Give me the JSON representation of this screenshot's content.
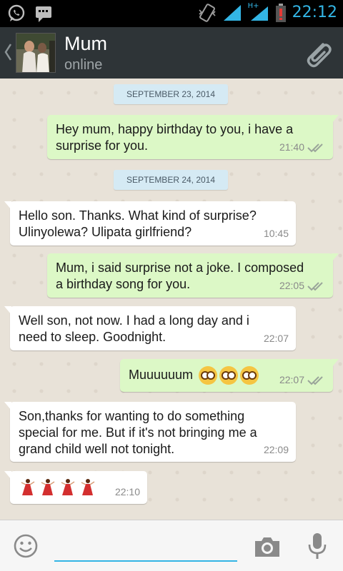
{
  "status_bar": {
    "time": "22:12",
    "network": "H+",
    "left_icons": [
      "whatsapp-icon",
      "message-icon"
    ],
    "right_icons": [
      "vibrate-icon",
      "signal-icon",
      "signal-icon",
      "battery-low-icon"
    ]
  },
  "header": {
    "contact_name": "Mum",
    "status": "online",
    "icons": [
      "back-chevron-icon",
      "avatar",
      "paperclip-icon"
    ]
  },
  "conversation": {
    "dates": [
      "SEPTEMBER 23, 2014",
      "SEPTEMBER 24, 2014"
    ],
    "messages": [
      {
        "direction": "out",
        "line1": "Hey mum, happy birthday to you, i have a",
        "line2": "surprise for you.",
        "time": "21:40",
        "ticks": "double"
      },
      {
        "direction": "in",
        "line1": "Hello son. Thanks. What kind of surprise?",
        "line2": "Ulinyolewa? Ulipata girlfriend?",
        "time": "10:45"
      },
      {
        "direction": "out",
        "line1": "Mum, i said surprise not a joke. I composed",
        "line2": "a birthday song for you.",
        "time": "22:05",
        "ticks": "double"
      },
      {
        "direction": "in",
        "line1": "Well son, not now. I had a long day and i",
        "line2": "need to sleep. Goodnight.",
        "time": "22:07"
      },
      {
        "direction": "out",
        "text": "Muuuuuum",
        "emoji": [
          "flushed-face-emoji",
          "flushed-face-emoji",
          "flushed-face-emoji"
        ],
        "time": "22:07",
        "ticks": "double"
      },
      {
        "direction": "in",
        "line1": "Son,thanks for wanting to do something",
        "line2": "special for me. But if it's not bringing me a",
        "line3": "grand child well not tonight.",
        "time": "22:09"
      },
      {
        "direction": "in",
        "emoji": [
          "dancer-emoji",
          "dancer-emoji",
          "dancer-emoji",
          "dancer-emoji"
        ],
        "time": "22:10"
      }
    ]
  },
  "composer": {
    "value": "",
    "icons": [
      "smiley-icon",
      "camera-icon",
      "microphone-icon"
    ]
  },
  "colors": {
    "status_accent": "#33b5e5",
    "header_bg": "#2e3437",
    "outgoing_bubble": "#dcf8c6",
    "incoming_bubble": "#ffffff",
    "date_pill": "#d5eaf4",
    "battery_low": "#e53935"
  }
}
